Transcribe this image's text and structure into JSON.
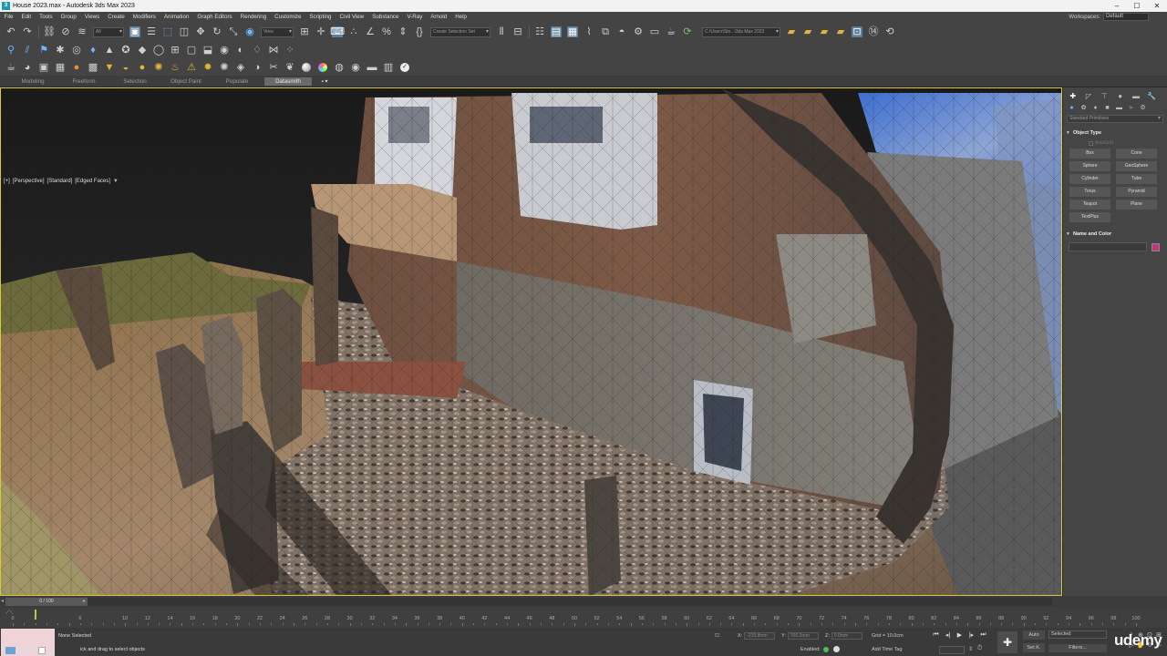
{
  "titlebar": {
    "app_icon": "3ds-max-icon",
    "title": "House 2023.max - Autodesk 3ds Max 2023",
    "minimize": "–",
    "maximize": "☐",
    "close": "✕"
  },
  "menubar": {
    "items": [
      "File",
      "Edit",
      "Tools",
      "Group",
      "Views",
      "Create",
      "Modifiers",
      "Animation",
      "Graph Editors",
      "Rendering",
      "Customize",
      "Scripting",
      "Civil View",
      "Substance",
      "V-Ray",
      "Arnold",
      "Help"
    ],
    "workspace_label": "Workspaces:",
    "workspace_value": "Default"
  },
  "toolbar": {
    "selection_filter": "All",
    "view_space": "View",
    "named_selection_set": "Create Selection Set",
    "project_path": "C:\\Users\\Sto...\\3ds Max 2023"
  },
  "ribbon": {
    "tabs": [
      "Modeling",
      "Freeform",
      "Selection",
      "Object Paint",
      "Populate",
      "Datasmith"
    ],
    "active_tab": "Datasmith",
    "dropmark": "▪ ▾"
  },
  "viewport": {
    "label_menu": "[+]",
    "label_view": "[Perspective]",
    "label_shading": "[Standard]",
    "label_display": "[Edged Faces]",
    "filter_icon": "filter-icon"
  },
  "command_panel": {
    "category_dropdown": "Standard Primitives",
    "object_type_title": "Object Type",
    "autogrid_label": "AutoGrid",
    "primitives": [
      "Box",
      "Cone",
      "Sphere",
      "GeoSphere",
      "Cylinder",
      "Tube",
      "Torus",
      "Pyramid",
      "Teapot",
      "Plane",
      "TextPlus"
    ],
    "name_color_title": "Name and Color",
    "object_color": "#c2377a"
  },
  "timeline": {
    "frame_display": "0 / 100",
    "prev_arrow": "◂",
    "next_arrow": "▸",
    "ticks": [
      "0",
      "2",
      "6",
      "10",
      "12",
      "14",
      "16",
      "18",
      "20",
      "22",
      "24",
      "26",
      "28",
      "30",
      "32",
      "34",
      "36",
      "38",
      "40",
      "42",
      "44",
      "46",
      "48",
      "50",
      "52",
      "54",
      "56",
      "58",
      "60",
      "62",
      "64",
      "66",
      "68",
      "70",
      "72",
      "74",
      "76",
      "78",
      "80",
      "82",
      "84",
      "86",
      "88",
      "90",
      "92",
      "94",
      "96",
      "98",
      "100"
    ]
  },
  "status": {
    "selection": "None Selected",
    "prompt": "ick and drag to select objects",
    "x_label": "X:",
    "x_value": "-215.8mm",
    "y_label": "Y:",
    "y_value": "700.3mm",
    "z_label": "Z:",
    "z_value": "0.0mm",
    "grid": "Grid = 10.0cm",
    "enabled": "Enabled:",
    "add_time_tag": "Add Time Tag",
    "auto": "Auto",
    "set_k": "Set K.",
    "selected": "Selected",
    "filters": "Filters...",
    "frame": "0"
  },
  "watermark": "udemy"
}
